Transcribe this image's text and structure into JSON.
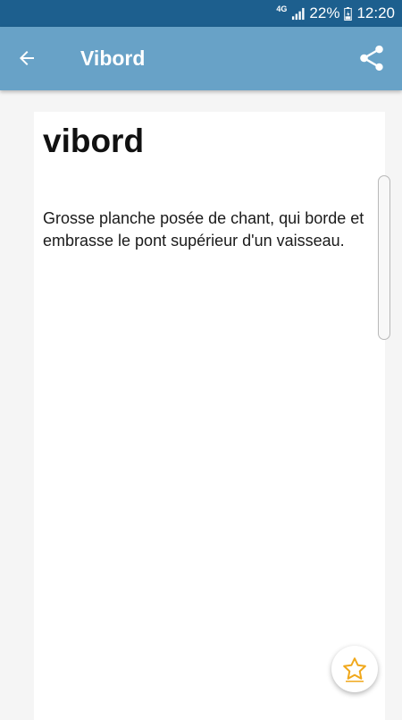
{
  "status_bar": {
    "network": "4G",
    "battery": "22%",
    "time": "12:20"
  },
  "toolbar": {
    "title": "Vibord",
    "back_icon": "arrow-left-icon",
    "share_icon": "share-icon"
  },
  "entry": {
    "word": "vibord",
    "definition": "Grosse planche posée de chant, qui borde et embrasse le pont supérieur d'un vaisseau."
  },
  "favorite": {
    "icon": "star-outline-icon"
  },
  "colors": {
    "status_bar": "#1d5f8e",
    "toolbar": "#68a2c7",
    "star": "#f0a81c"
  }
}
